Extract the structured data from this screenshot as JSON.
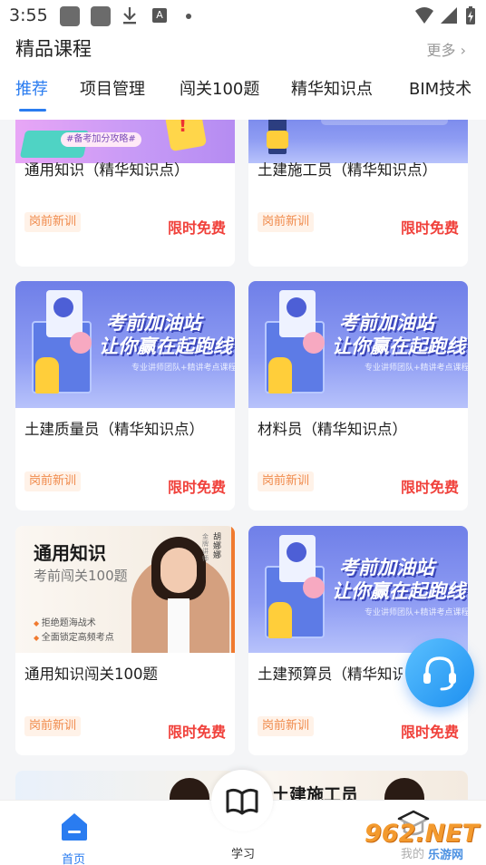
{
  "status_bar": {
    "time": "3:55",
    "notification_icons": [
      "app-icon",
      "app-icon",
      "download-icon",
      "a-icon",
      "dot-icon"
    ],
    "system_icons": [
      "wifi-icon",
      "signal-icon",
      "battery-icon"
    ]
  },
  "header": {
    "title": "精品课程",
    "more_label": "更多",
    "more_icon": "chevron-right-icon"
  },
  "tabs": [
    {
      "label": "推荐",
      "active": true
    },
    {
      "label": "项目管理",
      "active": false
    },
    {
      "label": "闯关100题",
      "active": false
    },
    {
      "label": "精华知识点",
      "active": false
    },
    {
      "label": "BIM技术",
      "active": false
    }
  ],
  "banners": {
    "partial_label": "#备考加分攻略#",
    "promo_line1": "考前加油站",
    "promo_line2": "让你赢在起跑线",
    "promo_sub": "专业讲师团队+精讲考点课程",
    "teacher_title": "通用知识",
    "teacher_subtitle": "考前闯关100题",
    "teacher_bullet1": "拒绝题海战术",
    "teacher_bullet2": "全面锁定高频考点",
    "teacher_badge": "胡娜娜",
    "teacher_badge2": "金牌讲师",
    "partial_bottom_right": "土建施工员"
  },
  "courses": [
    {
      "title": "通用知识（精华知识点）",
      "tag": "岗前新训",
      "price": "限时免费"
    },
    {
      "title": "土建施工员（精华知识点）",
      "tag": "岗前新训",
      "price": "限时免费"
    },
    {
      "title": "土建质量员（精华知识点）",
      "tag": "岗前新训",
      "price": "限时免费"
    },
    {
      "title": "材料员（精华知识点）",
      "tag": "岗前新训",
      "price": "限时免费"
    },
    {
      "title": "通用知识闯关100题",
      "tag": "岗前新训",
      "price": "限时免费"
    },
    {
      "title": "土建预算员（精华知识点）",
      "tag": "岗前新训",
      "price": "限时免费"
    }
  ],
  "floating_button": {
    "icon": "headset-icon"
  },
  "bottom_nav": {
    "home_label": "首页",
    "study_label": "学习",
    "mine_label": "我的",
    "home_icon": "home-icon",
    "study_icon": "book-icon",
    "mine_icon": "graduation-cap-icon"
  },
  "watermark": {
    "text": "962.NET",
    "sub": "乐游网"
  },
  "colors": {
    "accent": "#2a7cf0",
    "price": "#f0413b",
    "tag_text": "#f08a4b",
    "tag_bg": "#fff2e8"
  }
}
